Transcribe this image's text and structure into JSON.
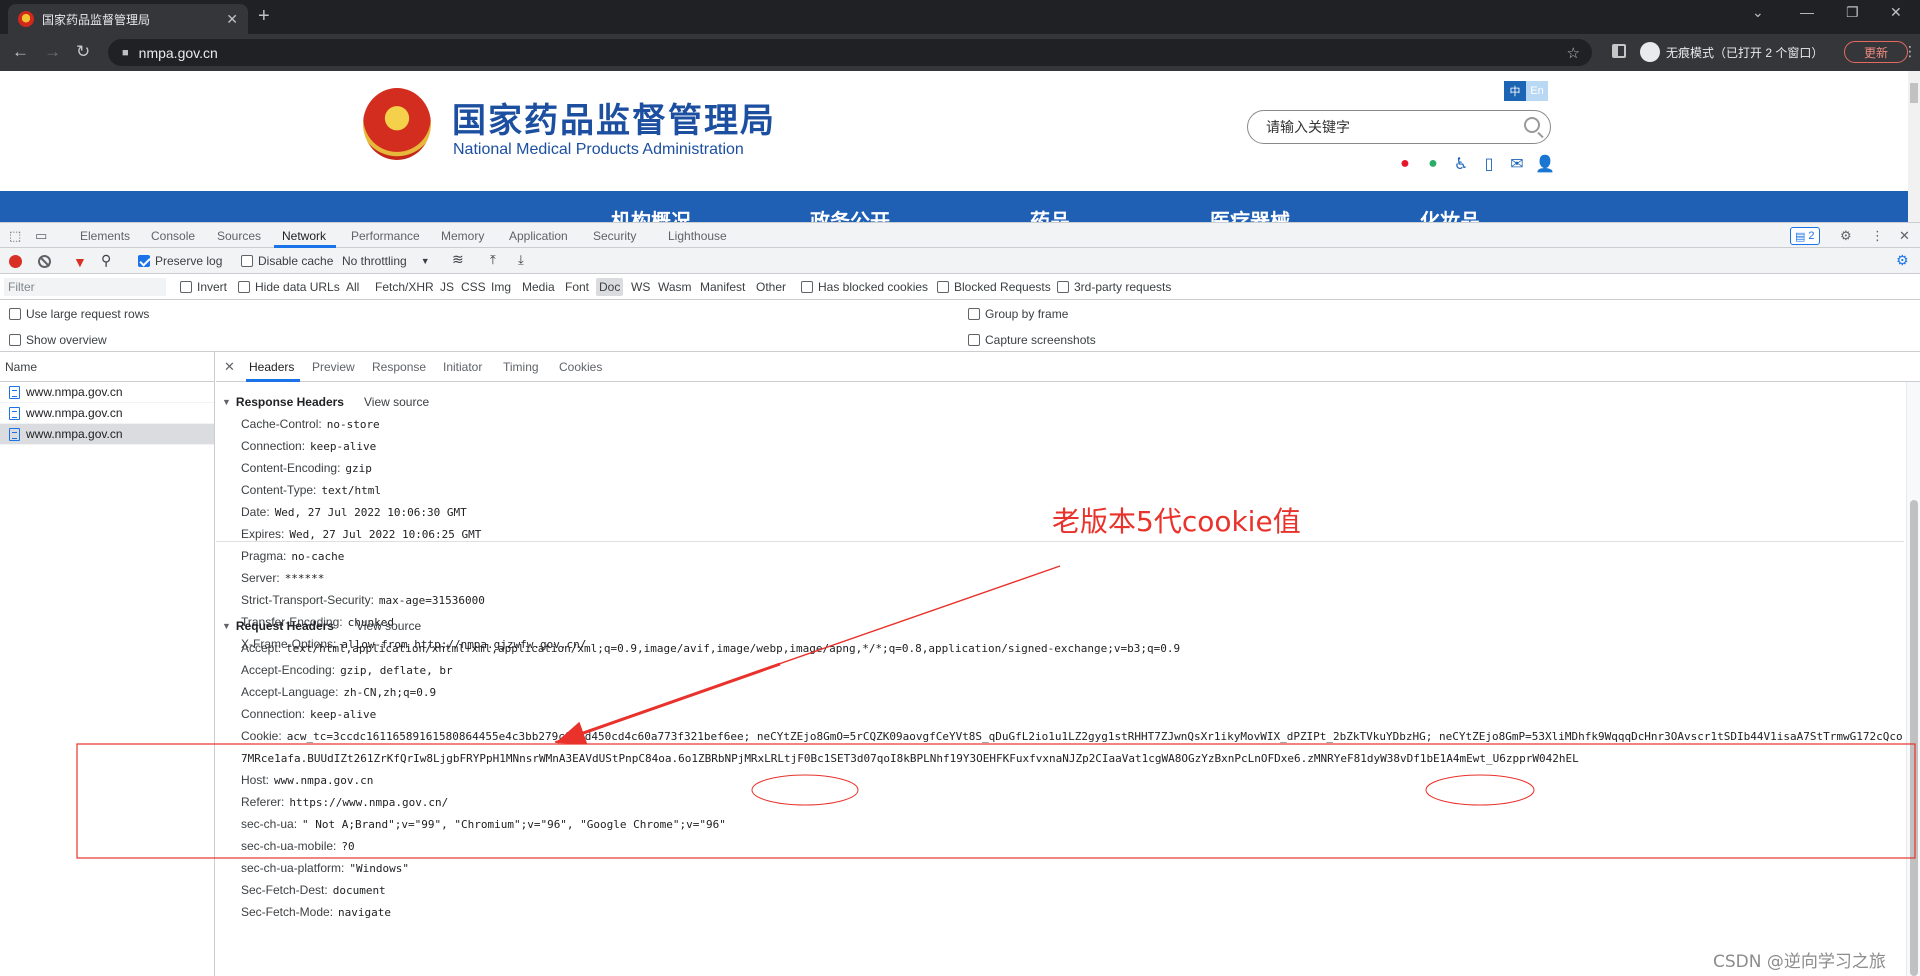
{
  "browser": {
    "tab_title": "国家药品监督管理局",
    "tab_close": "✕",
    "new_tab": "+",
    "url": "nmpa.gov.cn",
    "incognito_label": "无痕模式（已打开 2 个窗口）",
    "update_label": "更新",
    "icons": [
      "back-icon",
      "forward-icon",
      "reload-icon",
      "lock-icon",
      "star-icon",
      "side-panel-icon",
      "incognito-icon",
      "menu-icon"
    ]
  },
  "site": {
    "title_cn": "国家药品监督管理局",
    "title_en": "National Medical Products Administration",
    "lang_zh": "中",
    "lang_en": "En",
    "search_placeholder": "请输入关键字",
    "nav": [
      "机构概况",
      "政务公开",
      "药品",
      "医疗器械",
      "化妆品"
    ]
  },
  "devtools": {
    "tabs": [
      "Elements",
      "Console",
      "Sources",
      "Network",
      "Performance",
      "Memory",
      "Application",
      "Security",
      "Lighthouse"
    ],
    "active_tab": "Network",
    "issues_count": "2",
    "toolbar": {
      "preserve_log": "Preserve log",
      "disable_cache": "Disable cache",
      "throttling": "No throttling"
    },
    "filter": {
      "placeholder": "Filter",
      "invert": "Invert",
      "hide_data_urls": "Hide data URLs",
      "types": [
        "All",
        "Fetch/XHR",
        "JS",
        "CSS",
        "Img",
        "Media",
        "Font",
        "Doc",
        "WS",
        "Wasm",
        "Manifest",
        "Other"
      ],
      "selected_type": "Doc",
      "has_blocked_cookies": "Has blocked cookies",
      "blocked_requests": "Blocked Requests",
      "third_party": "3rd-party requests"
    },
    "options": {
      "large_rows": "Use large request rows",
      "show_overview": "Show overview",
      "group_by_frame": "Group by frame",
      "capture_screenshots": "Capture screenshots"
    },
    "request_list": {
      "header": "Name",
      "rows": [
        "www.nmpa.gov.cn",
        "www.nmpa.gov.cn",
        "www.nmpa.gov.cn"
      ]
    },
    "detail_tabs": [
      "Headers",
      "Preview",
      "Response",
      "Initiator",
      "Timing",
      "Cookies"
    ],
    "response_headers": {
      "title": "Response Headers",
      "view_source": "View source",
      "items": [
        {
          "k": "Cache-Control:",
          "v": "no-store"
        },
        {
          "k": "Connection:",
          "v": "keep-alive"
        },
        {
          "k": "Content-Encoding:",
          "v": "gzip"
        },
        {
          "k": "Content-Type:",
          "v": "text/html"
        },
        {
          "k": "Date:",
          "v": "Wed, 27 Jul 2022 10:06:30 GMT"
        },
        {
          "k": "Expires:",
          "v": "Wed, 27 Jul 2022 10:06:25 GMT"
        },
        {
          "k": "Pragma:",
          "v": "no-cache"
        },
        {
          "k": "Server:",
          "v": "******"
        },
        {
          "k": "Strict-Transport-Security:",
          "v": "max-age=31536000"
        },
        {
          "k": "Transfer-Encoding:",
          "v": "chunked"
        },
        {
          "k": "X-Frame-Options:",
          "v": "allow-from http://nmpa.gjzwfw.gov.cn/"
        }
      ]
    },
    "request_headers": {
      "title": "Request Headers",
      "view_source": "View source",
      "items": [
        {
          "k": "Accept:",
          "v": "text/html,application/xhtml+xml,application/xml;q=0.9,image/avif,image/webp,image/apng,*/*;q=0.8,application/signed-exchange;v=b3;q=0.9"
        },
        {
          "k": "Accept-Encoding:",
          "v": "gzip, deflate, br"
        },
        {
          "k": "Accept-Language:",
          "v": "zh-CN,zh;q=0.9"
        },
        {
          "k": "Connection:",
          "v": "keep-alive"
        },
        {
          "k": "Cookie:",
          "v": "acw_tc=3ccdc16116589161580864455e4c3bb279c03ad450cd4c60a773f321bef6ee; neCYtZEjo8GmO=5rCQZK09aovgfCeYVt8S_qDuGfL2io1u1LZ2gyg1stRHHT7ZJwnQsXr1ikyMovWIX_dPZIPt_2bZkTVkuYDbzHG; neCYtZEjo8GmP=53XliMDhfk9WqqqDcHnr3OAvscr1tSDIb44V1isaA7StTrmwG172cQco"
        },
        {
          "k": "",
          "v": "7MRce1afa.BUUdIZt261ZrKfQrIw8LjgbFRYPpH1MNnsrWMnA3EAVdUStPnpC84oa.6o1ZBRbNPjMRxLRLtjF0Bc1SET3d07qoI8kBPLNhf19Y3OEHFKFuxfvxnaNJZp2CIaaVat1cgWA8OGzYzBxnPcLnOFDxe6.zMNRYeF81dyW38vDf1bE1A4mEwt_U6zpprW042hEL"
        },
        {
          "k": "Host:",
          "v": "www.nmpa.gov.cn"
        },
        {
          "k": "Referer:",
          "v": "https://www.nmpa.gov.cn/"
        },
        {
          "k": "sec-ch-ua:",
          "v": "\" Not A;Brand\";v=\"99\", \"Chromium\";v=\"96\", \"Google Chrome\";v=\"96\""
        },
        {
          "k": "sec-ch-ua-mobile:",
          "v": "?0"
        },
        {
          "k": "sec-ch-ua-platform:",
          "v": "\"Windows\""
        },
        {
          "k": "Sec-Fetch-Dest:",
          "v": "document"
        },
        {
          "k": "Sec-Fetch-Mode:",
          "v": "navigate"
        }
      ]
    }
  },
  "annotation": {
    "label": "老版本5代cookie值",
    "color": "#e8322b"
  },
  "watermark": "CSDN @逆向学习之旅"
}
